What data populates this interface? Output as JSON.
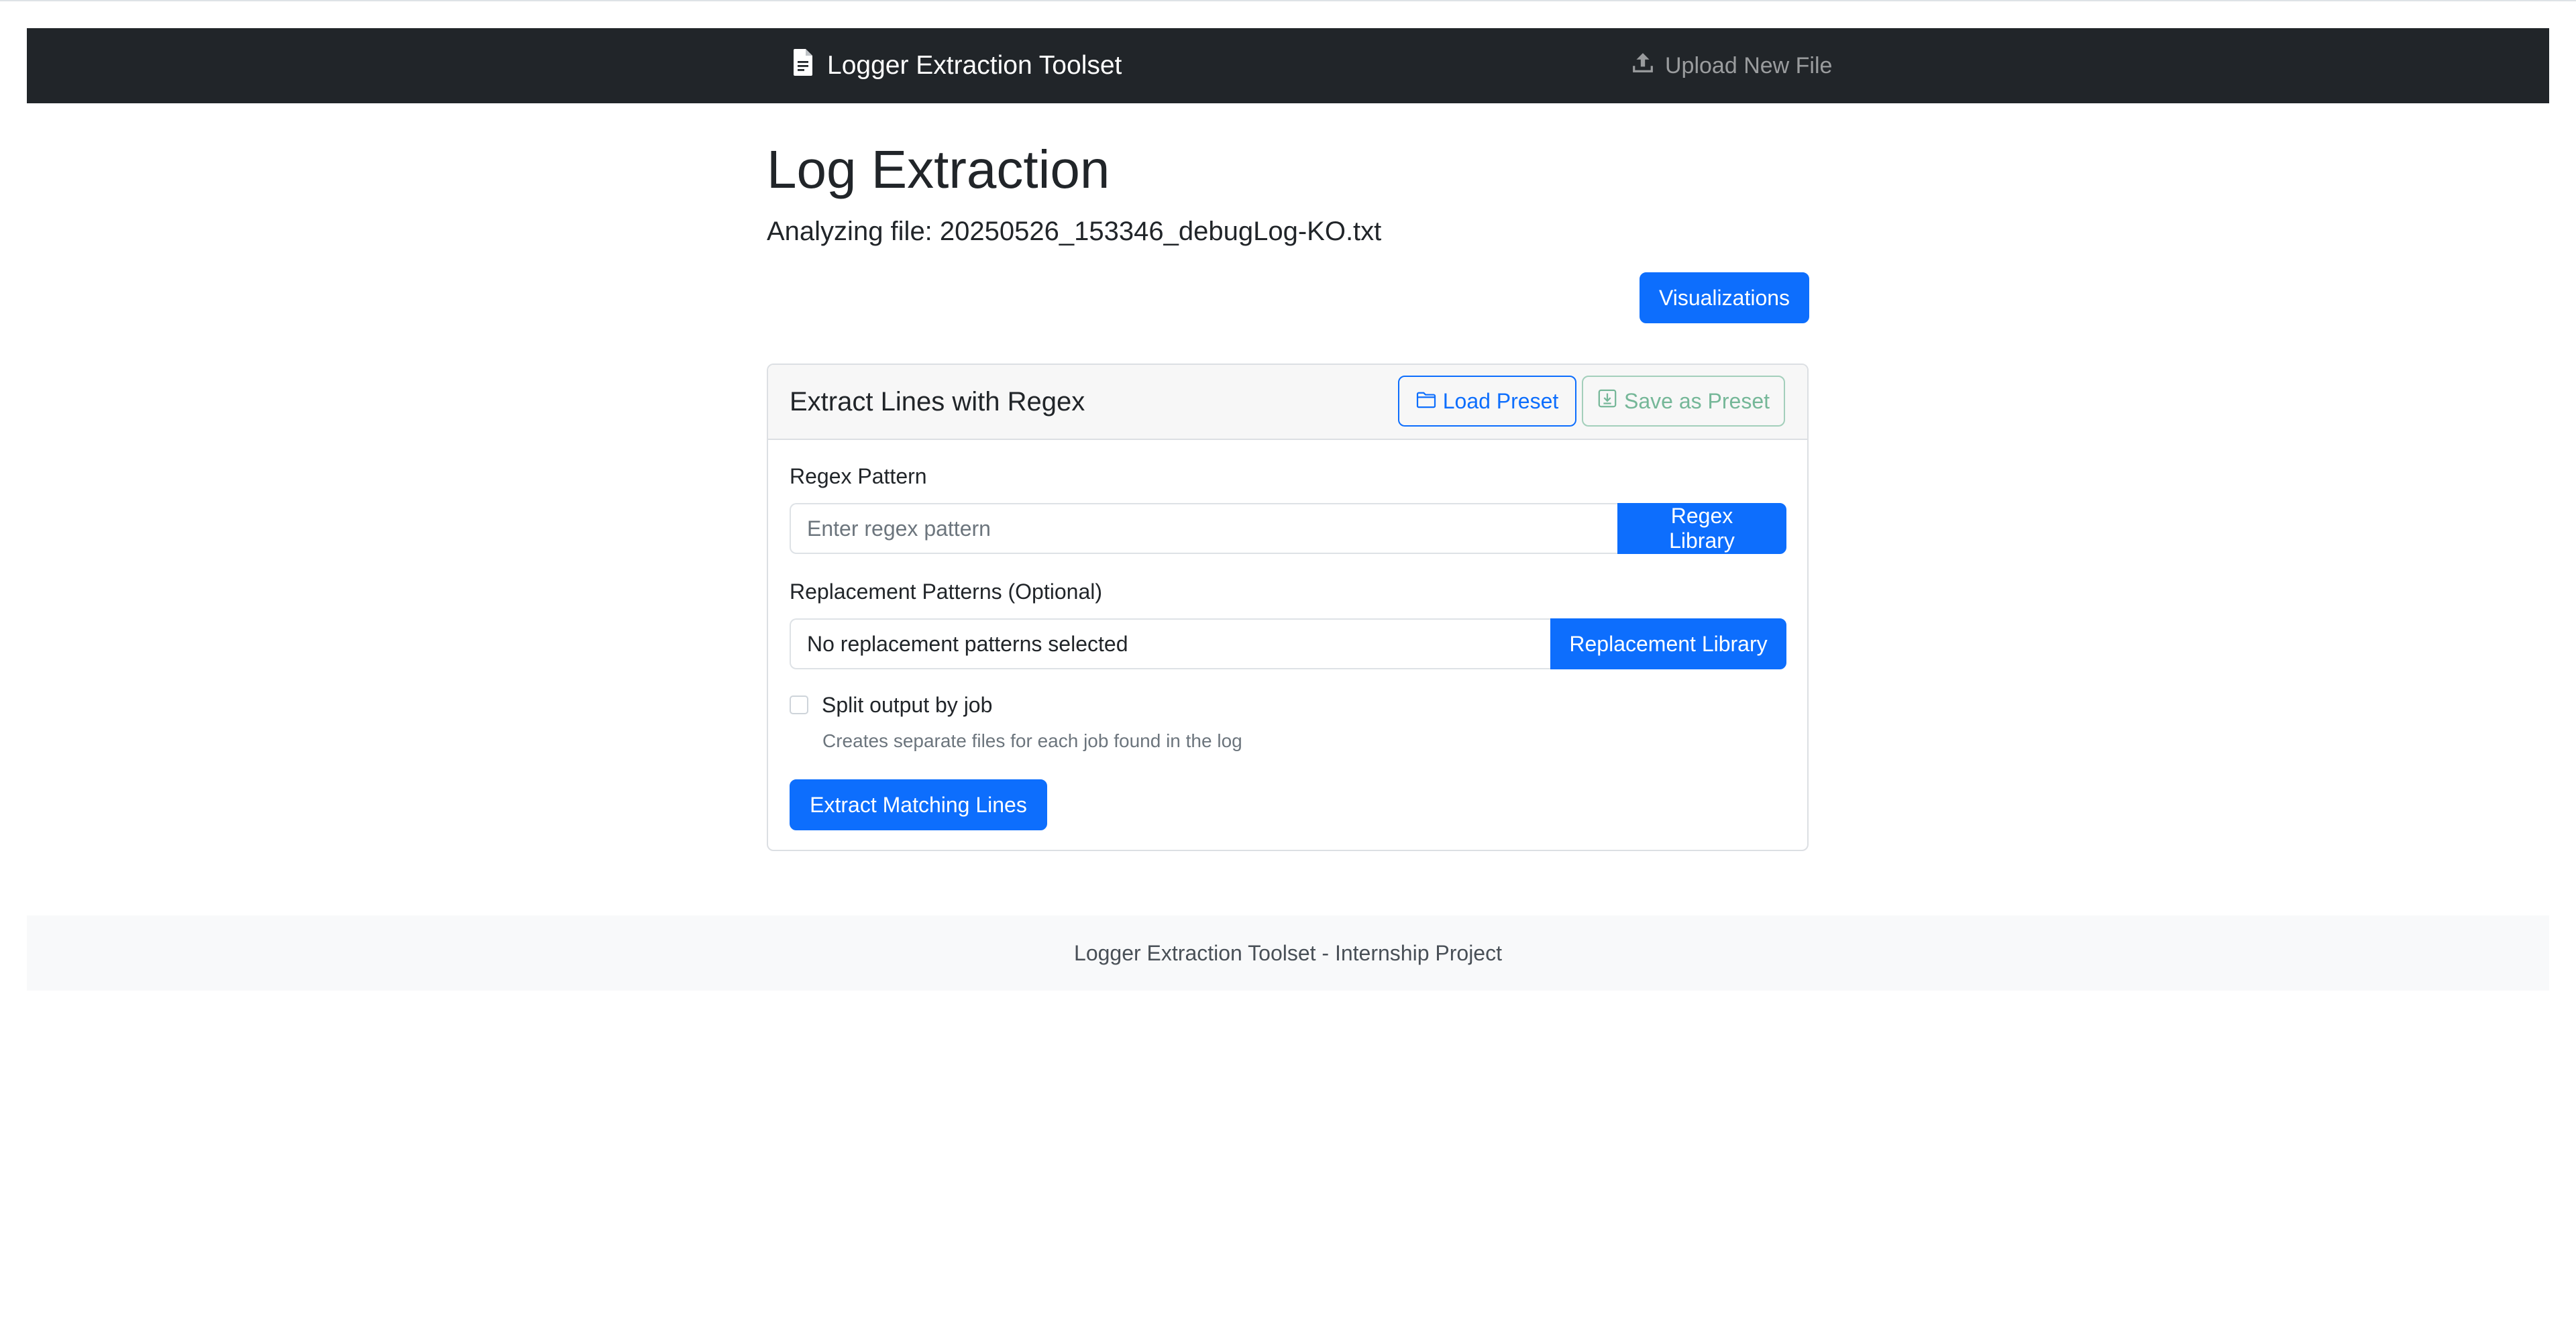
{
  "navbar": {
    "brand": "Logger Extraction Toolset",
    "brand_icon": "file-text-icon",
    "upload_label": "Upload New File",
    "upload_icon": "upload-icon"
  },
  "page": {
    "title": "Log Extraction",
    "file_prefix": "Analyzing file:",
    "file_name": "20250526_153346_debugLog-KO.txt",
    "visualizations_button": "Visualizations"
  },
  "card": {
    "title": "Extract Lines with Regex",
    "load_preset": "Load Preset",
    "save_preset": "Save as Preset",
    "regex": {
      "label": "Regex Pattern",
      "placeholder": "Enter regex pattern",
      "value": "",
      "library_button": "Regex Library"
    },
    "replacement": {
      "label": "Replacement Patterns (Optional)",
      "value": "No replacement patterns selected",
      "library_button": "Replacement Library"
    },
    "split": {
      "label": "Split output by job",
      "checked": false,
      "help": "Creates separate files for each job found in the log"
    },
    "extract_button": "Extract Matching Lines"
  },
  "footer": {
    "text": "Logger Extraction Toolset - Internship Project"
  },
  "colors": {
    "navbar_bg": "#212529",
    "primary": "#0d6efd",
    "success_outline": "#75b798",
    "footer_bg": "#f8f9fa"
  }
}
